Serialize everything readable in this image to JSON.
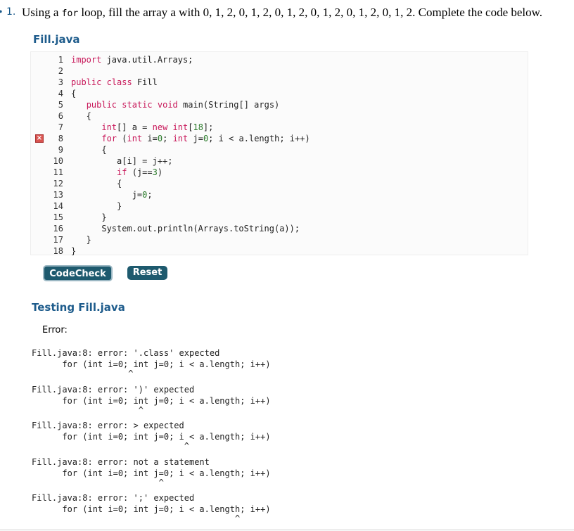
{
  "question": {
    "bullet": "•",
    "number": "1",
    "text_before": "Using a ",
    "code_word": "for",
    "text_after": " loop, fill the array a with 0, 1, 2, 0, 1, 2, 0, 1, 2, 0, 1, 2, 0, 1, 2, 0, 1, 2. Complete the code below."
  },
  "file_title": "Fill.java",
  "editor": {
    "error_line": 8,
    "lines": [
      {
        "num": "1",
        "tokens": [
          {
            "t": "import",
            "c": "kw"
          },
          {
            "t": " java.util.Arrays;"
          }
        ]
      },
      {
        "num": "2",
        "tokens": []
      },
      {
        "num": "3",
        "tokens": [
          {
            "t": "public",
            "c": "kw"
          },
          {
            "t": " "
          },
          {
            "t": "class",
            "c": "kw"
          },
          {
            "t": " Fill"
          }
        ]
      },
      {
        "num": "4",
        "tokens": [
          {
            "t": "{"
          }
        ]
      },
      {
        "num": "5",
        "tokens": [
          {
            "t": "   "
          },
          {
            "t": "public",
            "c": "kw"
          },
          {
            "t": " "
          },
          {
            "t": "static",
            "c": "kw"
          },
          {
            "t": " "
          },
          {
            "t": "void",
            "c": "kw"
          },
          {
            "t": " main(String[] args)"
          }
        ]
      },
      {
        "num": "6",
        "tokens": [
          {
            "t": "   {"
          }
        ]
      },
      {
        "num": "7",
        "tokens": [
          {
            "t": "      "
          },
          {
            "t": "int",
            "c": "kw"
          },
          {
            "t": "[] a = "
          },
          {
            "t": "new",
            "c": "kw"
          },
          {
            "t": " "
          },
          {
            "t": "int",
            "c": "kw"
          },
          {
            "t": "["
          },
          {
            "t": "18",
            "c": "num"
          },
          {
            "t": "];"
          }
        ]
      },
      {
        "num": "8",
        "tokens": [
          {
            "t": "      "
          },
          {
            "t": "for",
            "c": "kw"
          },
          {
            "t": " ("
          },
          {
            "t": "int",
            "c": "kw"
          },
          {
            "t": " i="
          },
          {
            "t": "0",
            "c": "num"
          },
          {
            "t": "; "
          },
          {
            "t": "int",
            "c": "kw"
          },
          {
            "t": " j="
          },
          {
            "t": "0",
            "c": "num"
          },
          {
            "t": "; i < a.length; i++)"
          }
        ]
      },
      {
        "num": "9",
        "tokens": [
          {
            "t": "      {"
          }
        ]
      },
      {
        "num": "10",
        "tokens": [
          {
            "t": "         a[i] = j++;"
          }
        ]
      },
      {
        "num": "11",
        "tokens": [
          {
            "t": "         "
          },
          {
            "t": "if",
            "c": "kw"
          },
          {
            "t": " (j=="
          },
          {
            "t": "3",
            "c": "num"
          },
          {
            "t": ")"
          }
        ]
      },
      {
        "num": "12",
        "tokens": [
          {
            "t": "         {"
          }
        ]
      },
      {
        "num": "13",
        "tokens": [
          {
            "t": "            j="
          },
          {
            "t": "0",
            "c": "num"
          },
          {
            "t": ";"
          }
        ]
      },
      {
        "num": "14",
        "tokens": [
          {
            "t": "         }"
          }
        ]
      },
      {
        "num": "15",
        "tokens": [
          {
            "t": "      }"
          }
        ]
      },
      {
        "num": "16",
        "tokens": [
          {
            "t": "      System.out.println(Arrays.toString(a));"
          }
        ]
      },
      {
        "num": "17",
        "tokens": [
          {
            "t": "   }"
          }
        ]
      },
      {
        "num": "18",
        "tokens": [
          {
            "t": "}"
          }
        ]
      }
    ]
  },
  "buttons": {
    "codecheck": "CodeCheck",
    "reset": "Reset"
  },
  "testing_title": "Testing Fill.java",
  "error_label": "Error:",
  "errors": [
    {
      "message": "Fill.java:8: error: '.class' expected",
      "source": "      for (int i=0; int j=0; i < a.length; i++)",
      "caret": "                   ^"
    },
    {
      "message": "Fill.java:8: error: ')' expected",
      "source": "      for (int i=0; int j=0; i < a.length; i++)",
      "caret": "                     ^"
    },
    {
      "message": "Fill.java:8: error: > expected",
      "source": "      for (int i=0; int j=0; i < a.length; i++)",
      "caret": "                              ^"
    },
    {
      "message": "Fill.java:8: error: not a statement",
      "source": "      for (int i=0; int j=0; i < a.length; i++)",
      "caret": "                         ^"
    },
    {
      "message": "Fill.java:8: error: ';' expected",
      "source": "      for (int i=0; int j=0; i < a.length; i++)",
      "caret": "                                        ^"
    }
  ]
}
